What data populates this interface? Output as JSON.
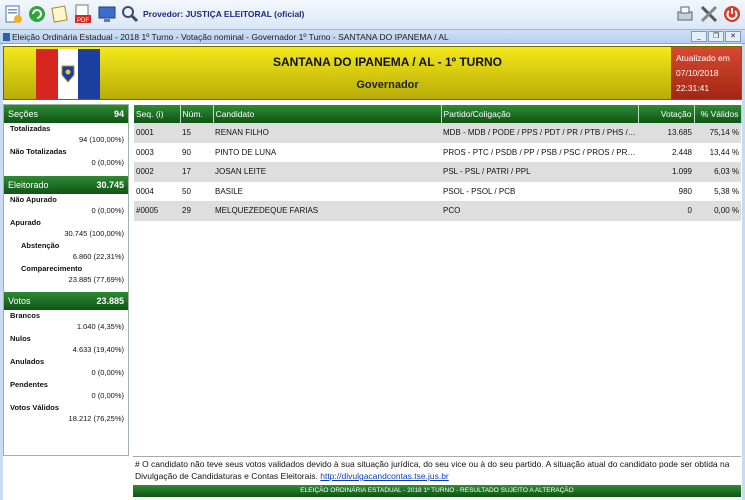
{
  "toolbar": {
    "provider_label": "Provedor: JUSTIÇA ELEITORAL (oficial)"
  },
  "window": {
    "title": "Eleição Ordinária Estadual - 2018 1º Turno - Votação nominal - Governador 1º Turno - SANTANA DO IPANEMA / AL"
  },
  "header": {
    "title": "SANTANA DO IPANEMA / AL - 1º TURNO",
    "subtitle": "Governador",
    "updated_label": "Atualizado em",
    "updated_date": "07/10/2018",
    "updated_time": "22:31:41"
  },
  "colors": {
    "green_header": "#1f6f25",
    "yellow_header": "#e5d90f",
    "updated_bg": "#c0391f"
  },
  "summary": {
    "secoes": {
      "label": "Seções",
      "value": "94",
      "items": [
        {
          "label": "Totalizadas",
          "value": "94 (100,00%)"
        },
        {
          "label": "Não Totalizadas",
          "value": "0 (0,00%)"
        }
      ]
    },
    "eleitorado": {
      "label": "Eleitorado",
      "value": "30.745",
      "items": [
        {
          "label": "Não Apurado",
          "value": "0 (0,00%)"
        },
        {
          "label": "Apurado",
          "value": "30.745 (100,00%)"
        },
        {
          "label": "Abstenção",
          "value": "6.860 (22,31%)"
        },
        {
          "label": "Comparecimento",
          "value": "23.885 (77,69%)"
        }
      ]
    },
    "votos": {
      "label": "Votos",
      "value": "23.885",
      "items": [
        {
          "label": "Brancos",
          "value": "1.040 (4,35%)"
        },
        {
          "label": "Nulos",
          "value": "4.633 (19,40%)"
        },
        {
          "label": "Anulados",
          "value": "0 (0,00%)"
        },
        {
          "label": "Pendentes",
          "value": "0 (0,00%)"
        },
        {
          "label": "Votos Válidos",
          "value": "18.212 (76,25%)"
        }
      ]
    }
  },
  "table": {
    "columns": [
      "Seq. (i)",
      "Núm.",
      "Candidato",
      "Partido/Coligação",
      "Votação",
      "% Válidos"
    ],
    "rows": [
      [
        "0001",
        "15",
        "RENAN FILHO",
        "MDB - MDB / PODE / PPS / PDT / PR / PTB / PHS / PV / PSD / PT / PC do B",
        "13.685",
        "75,14 %"
      ],
      [
        "0003",
        "90",
        "PINTO DE LUNA",
        "PROS - PTC / PSDB / PP / PSB / PSC / PROS / PRB / DEM",
        "2.448",
        "13,44 %"
      ],
      [
        "0002",
        "17",
        "JOSAN LEITE",
        "PSL - PSL / PATRI / PPL",
        "1.099",
        "6,03 %"
      ],
      [
        "0004",
        "50",
        "BASILE",
        "PSOL - PSOL / PCB",
        "980",
        "5,38 %"
      ],
      [
        "#0005",
        "29",
        "MELQUEZEDEQUE FARIAS",
        "PCO",
        "0",
        "0,00 %"
      ]
    ]
  },
  "footnote": {
    "text": "# O candidato não teve seus votos validados devido à sua situação jurídica, do seu vice ou à do seu partido. A situação atual do candidato pode ser obtida na Divulgação de Candidaturas e Contas Eleitorais.",
    "link": "http://divulgacandcontas.tse.jus.br"
  },
  "status_bar": "ELEIÇÃO ORDINÁRIA ESTADUAL - 2018 1º TURNO - RESULTADO SUJEITO A ALTERAÇÃO"
}
